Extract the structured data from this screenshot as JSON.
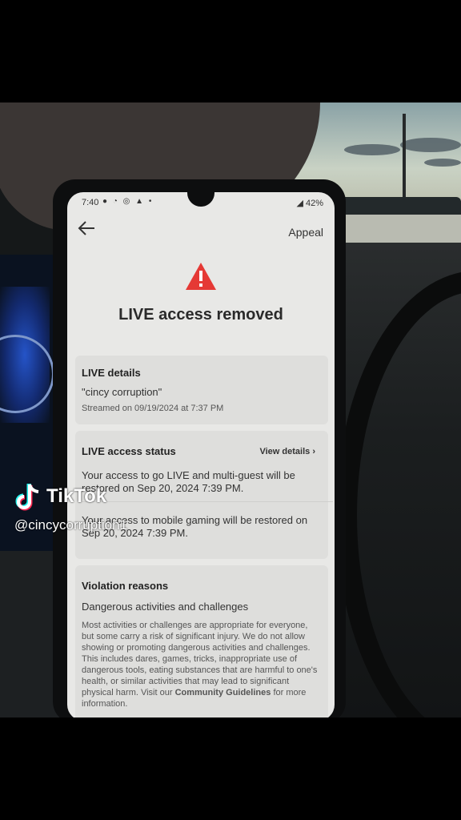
{
  "status_bar": {
    "time": "7:40",
    "battery": "42%"
  },
  "header": {
    "appeal_label": "Appeal"
  },
  "headline": "LIVE access removed",
  "live_details": {
    "title": "LIVE details",
    "stream_name": "\"cincy corruption\"",
    "streamed_on": "Streamed on 09/19/2024 at 7:37 PM"
  },
  "access_status": {
    "title": "LIVE access status",
    "view_details_label": "View details",
    "live_restore_text": "Your access to go LIVE and multi-guest will be restored on Sep 20, 2024 7:39 PM.",
    "gaming_restore_text": "Your access to mobile gaming will be restored on Sep 20, 2024 7:39 PM."
  },
  "violation": {
    "title": "Violation reasons",
    "reason": "Dangerous activities and challenges",
    "description": "Most activities or challenges are appropriate for everyone, but some carry a risk of significant injury. We do not allow showing or promoting dangerous activities and challenges. This includes dares, games, tricks, inappropriate use of dangerous tools, eating substances that are harmful to one's health, or similar activities that may lead to significant physical harm. Visit our",
    "link_label": "Community Guidelines",
    "link_suffix": "for more information."
  },
  "watermark": {
    "brand": "TikTok",
    "handle": "@cincycorruption1"
  },
  "colors": {
    "warning_red": "#e53935",
    "screen_bg": "#e8e8e6"
  }
}
